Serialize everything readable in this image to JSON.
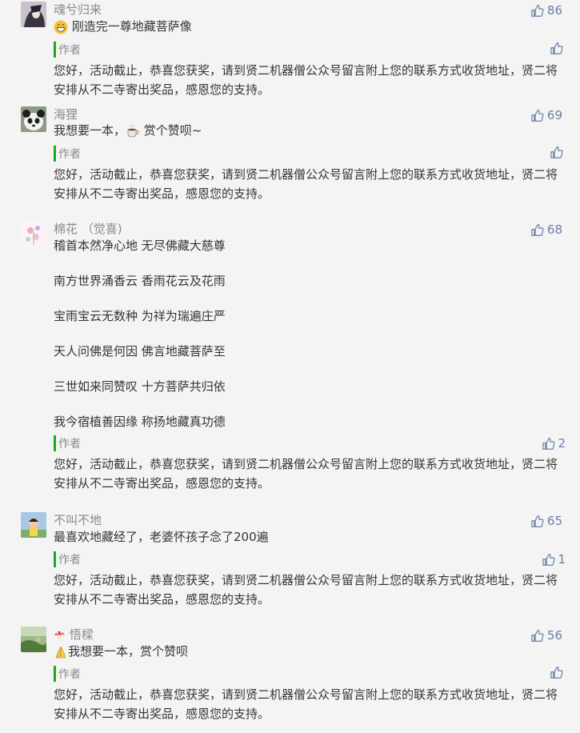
{
  "colors": {
    "accent_bar": "#1aad19",
    "like": "#6a7fa5",
    "nick": "#8a8a8a",
    "text": "#353535"
  },
  "author_reply": {
    "label": "作者",
    "text": "您好，活动截止，恭喜您获奖，请到贤二机器僧公众号留言附上您的联系方式收货地址，贤二将安排从不二寺寄出奖品，感恩您的支持。"
  },
  "comments": [
    {
      "nickname": "魂兮归来",
      "likes": "86",
      "emoji": "grinning-emoji",
      "text": " 刚造完一尊地藏菩萨像",
      "reply_likes": ""
    },
    {
      "nickname": "海狸",
      "likes": "69",
      "text": "我想要一本，",
      "text_after_icon": " 赏个赞呗~",
      "icon": "coffee-cup-emoji",
      "reply_likes": ""
    },
    {
      "nickname": "棉花 （觉喜)",
      "likes": "68",
      "paragraphs": [
        "稽首本然净心地 无尽佛藏大慈尊",
        "南方世界涌香云 香雨花云及花雨",
        "宝雨宝云无数种 为祥为瑞遍庄严",
        "天人问佛是何因 佛言地藏菩萨至",
        "三世如来同赞叹 十方菩萨共归依",
        "我今宿植善因缘 称扬地藏真功德"
      ],
      "reply_likes": "2"
    },
    {
      "nickname": "不叫不地",
      "likes": "65",
      "text": "最喜欢地藏经了，老婆怀孩子念了200遍",
      "reply_likes": "1"
    },
    {
      "nickname": "悟樑",
      "nick_icon": "mushroom-emoji",
      "likes": "56",
      "emoji": "folded-hands-emoji",
      "text": "我想要一本，赏个赞呗",
      "reply_likes": ""
    }
  ]
}
